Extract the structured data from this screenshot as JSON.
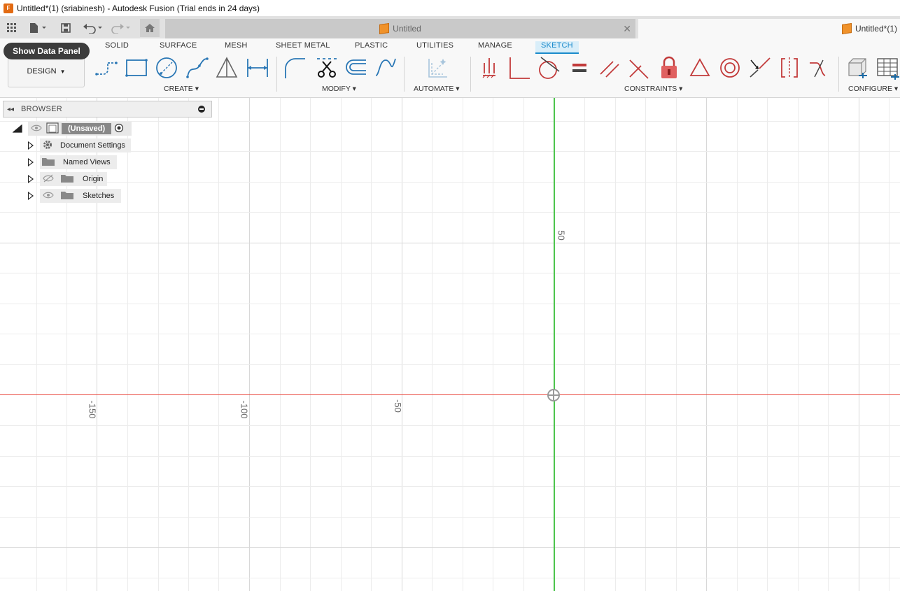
{
  "window": {
    "title": "Untitled*(1) (sriabinesh) - Autodesk Fusion (Trial ends in 24 days)",
    "logo_letter": "F"
  },
  "tabs": {
    "inactive_tab": "Untitled",
    "active_tab": "Untitled*(1)",
    "close_glyph": "✕"
  },
  "ribbon": {
    "show_data_panel": "Show Data Panel",
    "workspace": "DESIGN",
    "tabs": [
      "SOLID",
      "SURFACE",
      "MESH",
      "SHEET METAL",
      "PLASTIC",
      "UTILITIES",
      "MANAGE",
      "SKETCH"
    ],
    "active_tab": "SKETCH",
    "groups": [
      "CREATE",
      "MODIFY",
      "AUTOMATE",
      "CONSTRAINTS",
      "CONFIGURE"
    ],
    "create_tools": [
      "line-icon",
      "rectangle-icon",
      "circle-icon",
      "spline-icon",
      "triangle-icon",
      "dimension-icon"
    ],
    "modify_tools": [
      "fillet-icon",
      "trim-icon",
      "offset-icon",
      "curve-icon"
    ],
    "automate_tools": [
      "automated-dimension-icon"
    ],
    "constraint_tools": [
      "horizontal-vertical-icon",
      "coincident-icon",
      "tangent-icon",
      "equal-icon",
      "parallel-icon",
      "perpendicular-icon",
      "fix-lock-icon",
      "midpoint-triangle-icon",
      "concentric-icon",
      "collinear-icon",
      "symmetry-icon",
      "curvature-icon"
    ],
    "configure_tools": [
      "configure-icon",
      "table-icon"
    ]
  },
  "browser": {
    "title": "BROWSER",
    "root": "(Unsaved)",
    "items": [
      "Document Settings",
      "Named Views",
      "Origin",
      "Sketches"
    ]
  },
  "axes": {
    "x_labels": [
      "-150",
      "-100",
      "-50"
    ],
    "y_labels": [
      "50"
    ],
    "x_axis_color": "#e8473c",
    "y_axis_color": "#4cc44c",
    "accent": "#1a8acb"
  }
}
